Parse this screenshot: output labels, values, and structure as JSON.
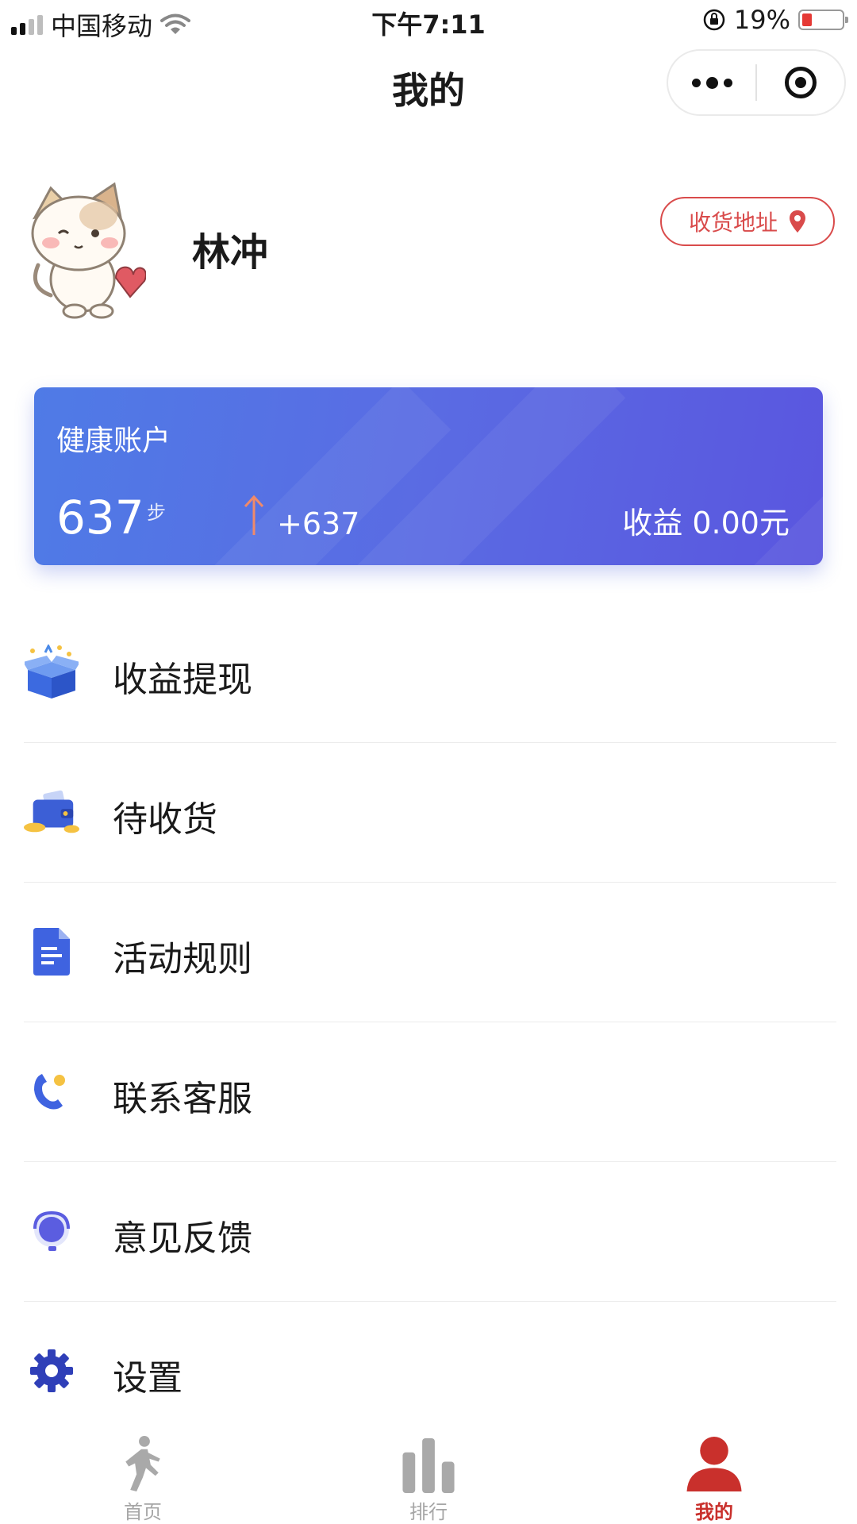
{
  "status_bar": {
    "carrier": "中国移动",
    "time": "下午7:11",
    "battery_percent": "19%",
    "battery_level": 0.19
  },
  "header": {
    "title": "我的"
  },
  "profile": {
    "username": "林冲",
    "address_button": "收货地址"
  },
  "health_card": {
    "title": "健康账户",
    "steps": "637",
    "steps_unit": "步",
    "delta": "+637",
    "income": "收益 0.00元"
  },
  "menu": [
    {
      "label": "收益提现",
      "icon": "gift-box-icon"
    },
    {
      "label": "待收货",
      "icon": "wallet-icon"
    },
    {
      "label": "活动规则",
      "icon": "document-icon"
    },
    {
      "label": "联系客服",
      "icon": "phone-icon"
    },
    {
      "label": "意见反馈",
      "icon": "feedback-icon"
    },
    {
      "label": "设置",
      "icon": "gear-icon"
    }
  ],
  "tabbar": {
    "items": [
      {
        "label": "首页",
        "icon": "running-person-icon",
        "active": false
      },
      {
        "label": "排行",
        "icon": "bar-chart-icon",
        "active": false
      },
      {
        "label": "我的",
        "icon": "person-icon",
        "active": true
      }
    ]
  },
  "colors": {
    "accent_red": "#c9302c",
    "card_gradient_start": "#4f7be6",
    "card_gradient_end": "#5a56df",
    "icon_blue": "#3f63e0"
  }
}
